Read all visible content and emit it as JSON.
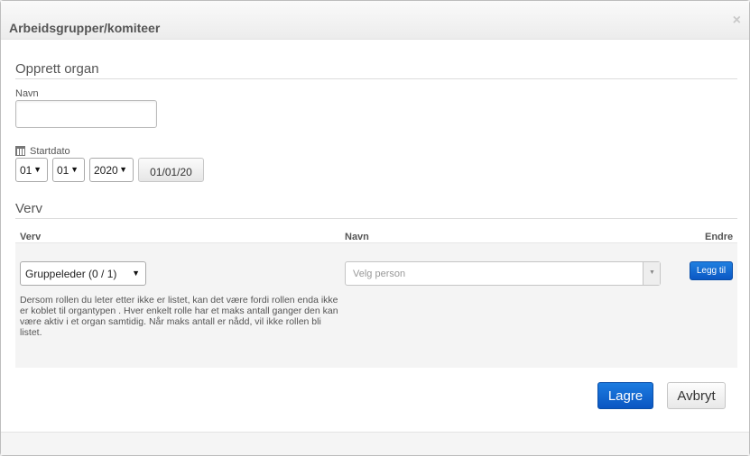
{
  "dialog": {
    "title": "Arbeidsgrupper/komiteer",
    "close_glyph": "×"
  },
  "create": {
    "heading": "Opprett organ",
    "name_label": "Navn",
    "name_value": "",
    "start_label": "Startdato",
    "day": "01",
    "month": "01",
    "year": "2020",
    "date_button": "01/01/20",
    "calendar_icon": "calendar-icon"
  },
  "roles": {
    "heading": "Verv",
    "columns": {
      "role": "Verv",
      "name": "Navn",
      "edit": "Endre"
    },
    "role_select": "Gruppeleder (0 / 1)",
    "person_placeholder": "Velg person",
    "add_label": "Legg til",
    "help_text": "Dersom rollen du leter etter ikke er listet, kan det være fordi rollen enda ikke er koblet til organtypen . Hver enkelt rolle har et maks antall ganger den kan være aktiv i et organ samtidig. Når maks antall er nådd, vil ikke rollen bli listet."
  },
  "footer": {
    "save_label": "Lagre",
    "cancel_label": "Avbryt"
  },
  "colors": {
    "primary": "#0b5fcc",
    "panel": "#f4f4f4"
  }
}
